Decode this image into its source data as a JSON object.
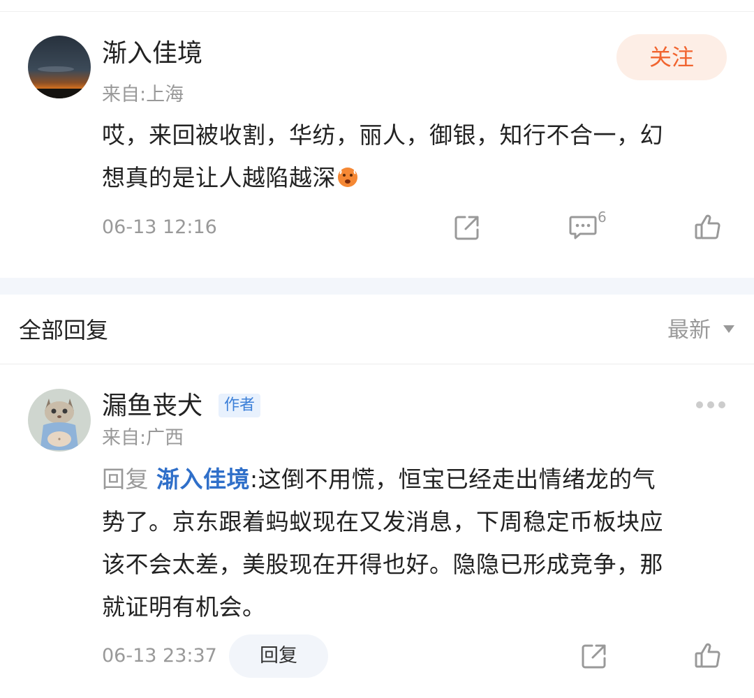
{
  "comment": {
    "user": {
      "name": "渐入佳境",
      "location": "来自:上海"
    },
    "follow_label": "关注",
    "text_line1": "哎，来回被收割，华纺，丽人，御银，知行不合一，幻",
    "text_line2": "想真的是让人越陷越深",
    "emoji": "hot-face-emoji",
    "time": "06-13 12:16",
    "reply_count": "6",
    "icons": [
      "share-icon",
      "comment-icon",
      "like-icon"
    ]
  },
  "replies_header": {
    "title": "全部回复",
    "sort_label": "最新"
  },
  "reply": {
    "user": {
      "name": "漏鱼丧犬",
      "location": "来自:广西"
    },
    "author_badge": "作者",
    "prefix": "回复",
    "target": "渐入佳境",
    "colon": ":",
    "text_line1_rest": "这倒不用慌，恒宝已经走出情绪龙的气",
    "text_line2": "势了。京东跟着蚂蚁现在又发消息，下周稳定币板块应",
    "text_line3": "该不会太差，美股现在开得也好。隐隐已形成竞争，那",
    "text_line4": "就证明有机会。",
    "time": "06-13 23:37",
    "reply_button_label": "回复",
    "icons": [
      "share-icon",
      "like-icon",
      "more-icon"
    ]
  },
  "colors": {
    "accent_orange": "#f1642f",
    "follow_bg": "#fdeee6",
    "link_blue": "#2f6fc9",
    "muted_gray": "#999999"
  }
}
